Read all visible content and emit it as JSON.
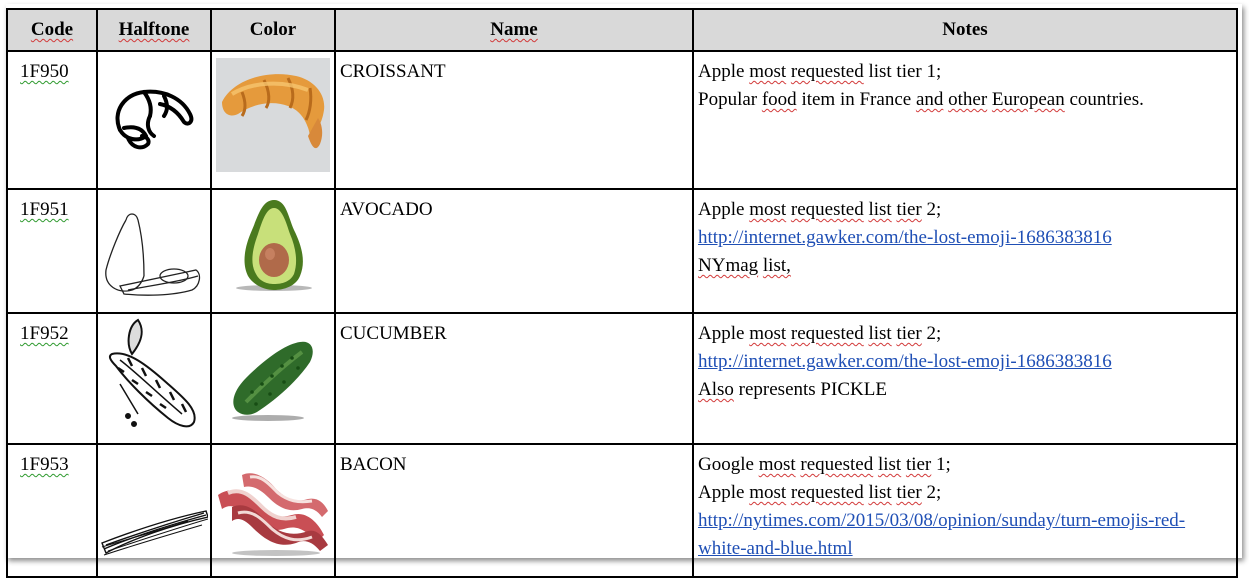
{
  "headers": {
    "code": "Code",
    "halftone": "Halftone",
    "color": "Color",
    "name": "Name",
    "notes": "Notes"
  },
  "rows": [
    {
      "code": "1F950",
      "name": "CROISSANT",
      "halftone_icon": "croissant-outline-icon",
      "color_icon": "croissant-color-icon",
      "notes": [
        {
          "pre": "Apple ",
          "sq": "most",
          "mid": " requested list tier 1;"
        },
        {
          "text": "Popular food item in France and other European countries."
        }
      ]
    },
    {
      "code": "1F951",
      "name": "AVOCADO",
      "halftone_icon": "avocado-outline-icon",
      "color_icon": "avocado-color-icon",
      "notes": [
        {
          "text": "Apple most requested list tier 2;"
        },
        {
          "link": "http://internet.gawker.com/the-lost-emoji-1686383816"
        },
        {
          "text": "NYmag  list,"
        }
      ]
    },
    {
      "code": "1F952",
      "name": "CUCUMBER",
      "halftone_icon": "cucumber-outline-icon",
      "color_icon": "cucumber-color-icon",
      "notes": [
        {
          "text": "Apple most requested list tier 2;"
        },
        {
          "link": "http://internet.gawker.com/the-lost-emoji-1686383816"
        },
        {
          "text": "Also represents PICKLE"
        }
      ]
    },
    {
      "code": "1F953",
      "name": "BACON",
      "halftone_icon": "bacon-outline-icon",
      "color_icon": "bacon-color-icon",
      "notes": [
        {
          "text": "Google most requested list tier 1;"
        },
        {
          "text": "Apple most requested list tier 2;"
        },
        {
          "link": "http://nytimes.com/2015/03/08/opinion/sunday/turn-emojis-red-white-and-blue.html"
        }
      ]
    }
  ]
}
